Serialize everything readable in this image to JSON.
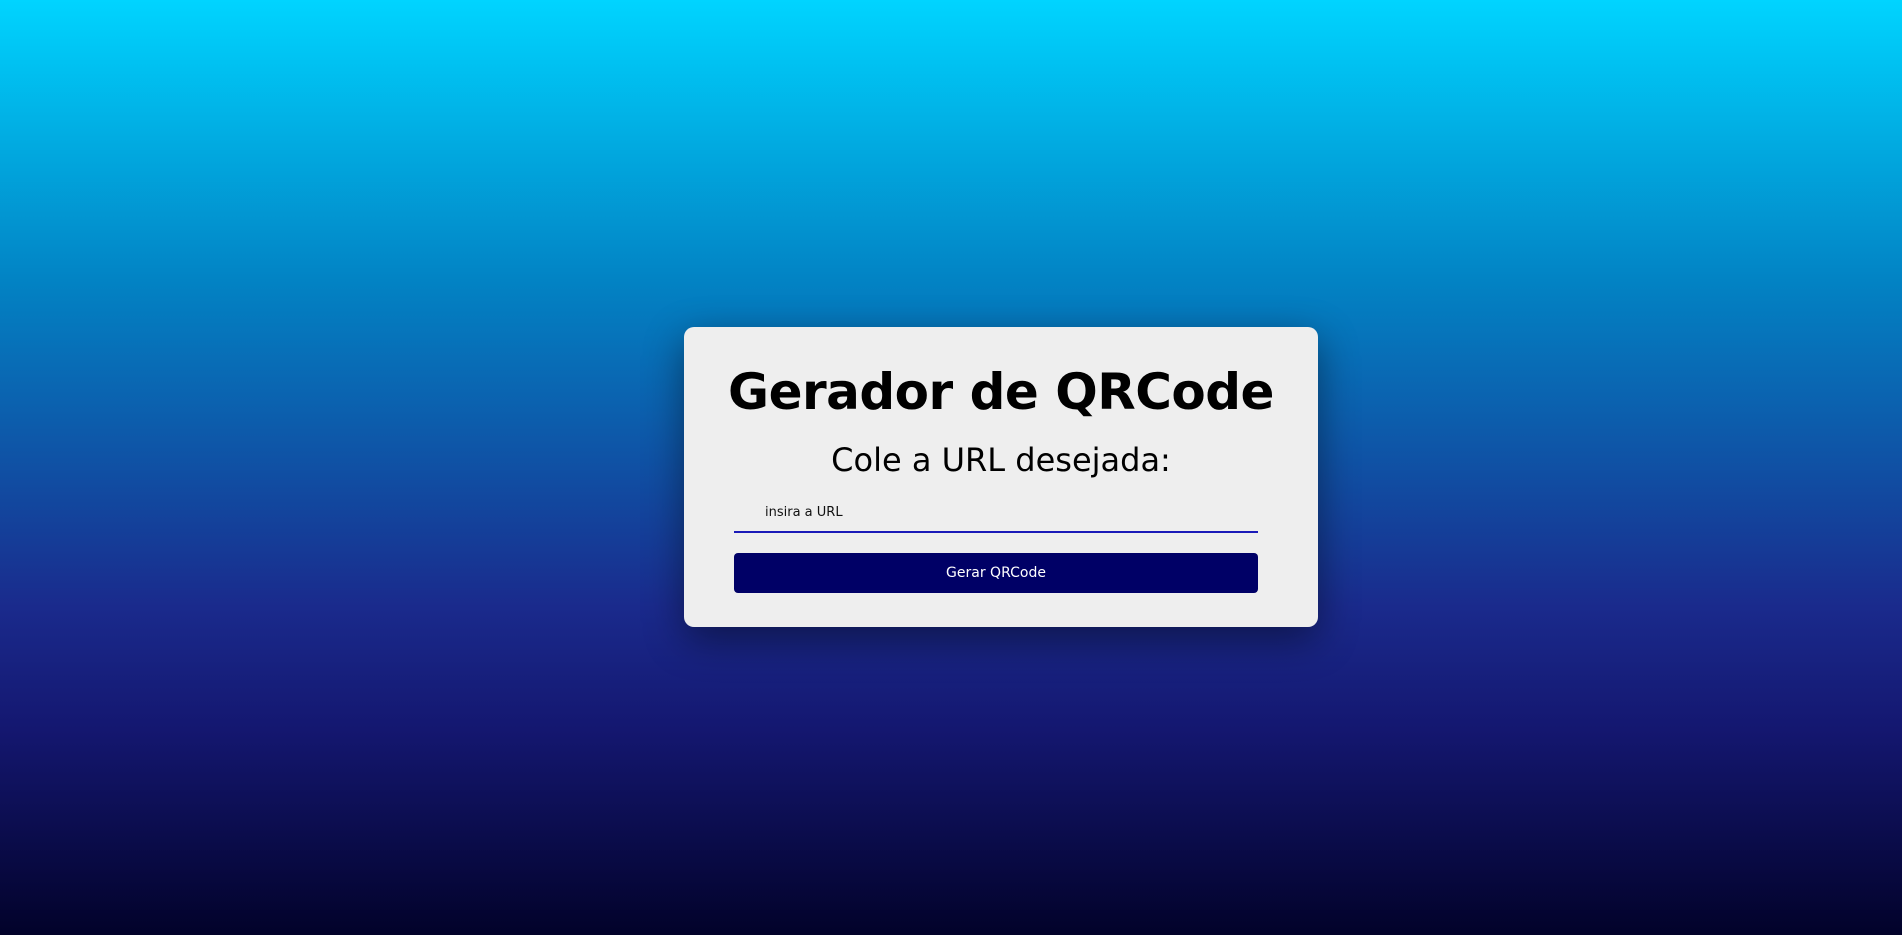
{
  "page": {
    "title": "Gerador de QRCode",
    "subtitle": "Cole a URL desejada:"
  },
  "form": {
    "url_placeholder": "insira a URL",
    "url_value": "",
    "submit_label": "Gerar QRCode"
  },
  "colors": {
    "background_top": "#00d4ff",
    "background_bottom": "#02022a",
    "card": "#eeeeee",
    "button": "#000066",
    "input_underline": "#1a1ab8"
  }
}
